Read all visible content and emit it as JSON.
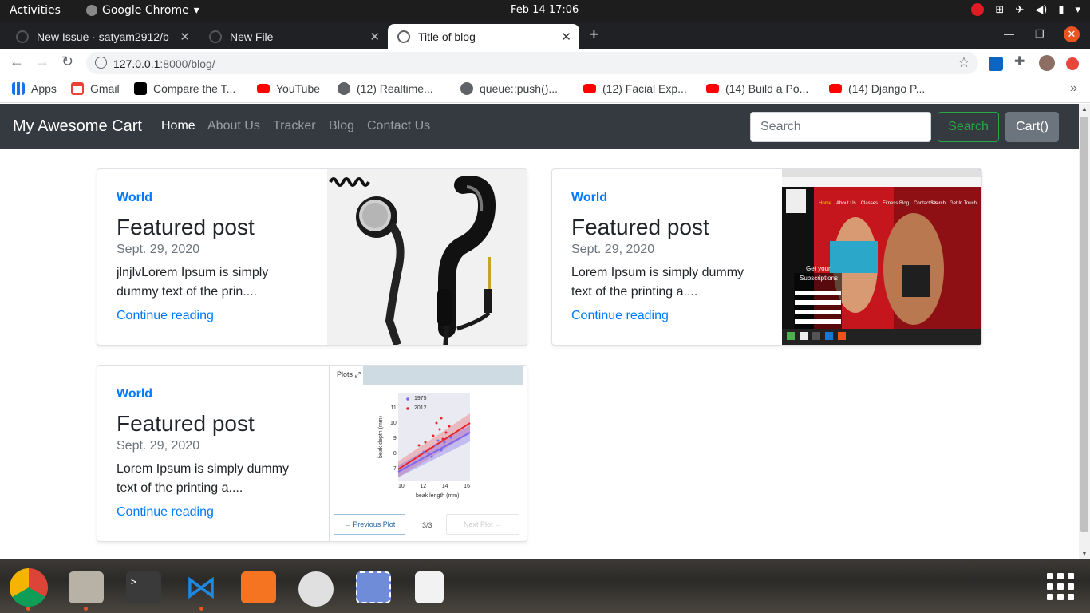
{
  "system": {
    "activities": "Activities",
    "app_name": "Google Chrome",
    "clock": "Feb 14  17:06"
  },
  "tabs": [
    {
      "label": "New Issue · satyam2912/b",
      "active": false
    },
    {
      "label": "New File",
      "active": false
    },
    {
      "label": "Title of blog",
      "active": true
    }
  ],
  "toolbar": {
    "url_host": "127.0.0.1",
    "url_path": ":8000/blog/"
  },
  "bookmarks": [
    {
      "label": "Apps",
      "icon": "apps-grid-icon"
    },
    {
      "label": "Gmail",
      "icon": "gmail-icon"
    },
    {
      "label": "Compare the T...",
      "icon": "hackerrank-icon"
    },
    {
      "label": "YouTube",
      "icon": "youtube-icon"
    },
    {
      "label": "(12) Realtime...",
      "icon": "globe-icon"
    },
    {
      "label": "queue::push()...",
      "icon": "globe-icon"
    },
    {
      "label": "(12) Facial Exp...",
      "icon": "youtube-icon"
    },
    {
      "label": "(14) Build a Po...",
      "icon": "youtube-icon"
    },
    {
      "label": "(14) Django P...",
      "icon": "youtube-icon"
    }
  ],
  "site": {
    "brand": "My Awesome Cart",
    "nav": [
      "Home",
      "About Us",
      "Tracker",
      "Blog",
      "Contact Us"
    ],
    "search_placeholder": "Search",
    "search_button": "Search",
    "cart_button": "Cart()"
  },
  "posts": [
    {
      "category": "World",
      "title": "Featured post",
      "date": "Sept. 29, 2020",
      "excerpt": "jlnjlvLorem Ipsum is simply dummy text of the prin....",
      "link": "Continue reading"
    },
    {
      "category": "World",
      "title": "Featured post",
      "date": "Sept. 29, 2020",
      "excerpt": "Lorem Ipsum is simply dummy text of the printing a....",
      "link": "Continue reading"
    },
    {
      "category": "World",
      "title": "Featured post",
      "date": "Sept. 29, 2020",
      "excerpt": "Lorem Ipsum is simply dummy text of the printing a....",
      "link": "Continue reading"
    }
  ],
  "fitness_thumb": {
    "nav": [
      "Home",
      "About Us",
      "Classes",
      "Fitness Blog",
      "Contact Us"
    ],
    "buttons": [
      "Search",
      "Get In Touch"
    ],
    "headline_1": "Get your",
    "headline_2": "Subscriptions"
  },
  "plot_thumb": {
    "tab": "Plots",
    "legend": [
      "1975",
      "2012"
    ],
    "ylabel": "beak depth (mm)",
    "xlabel": "beak length (mm)",
    "yticks": [
      "11",
      "10",
      "9",
      "8",
      "7"
    ],
    "xticks": [
      "10",
      "12",
      "14",
      "16"
    ],
    "prev": "Previous Plot",
    "page": "3/3",
    "next": "Next Plot",
    "series_colors": [
      "#7b68ee",
      "#e8262c"
    ]
  },
  "colors": {
    "navbar_bg": "#343a40",
    "link_blue": "#007bff",
    "search_green": "#28a745",
    "cart_grey": "#6c757d",
    "ubuntu_orange": "#e95420"
  }
}
